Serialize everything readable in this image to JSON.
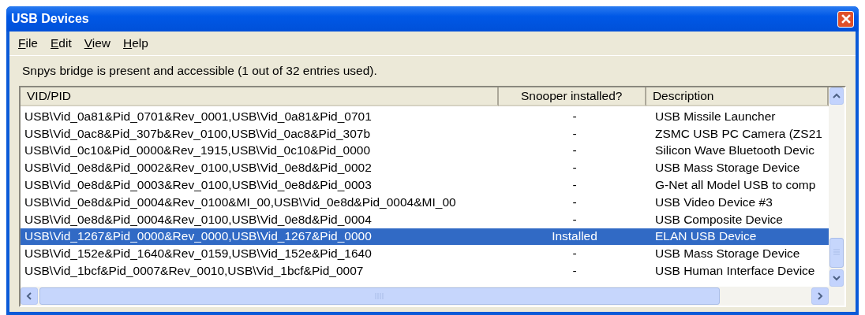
{
  "window": {
    "title": "USB Devices"
  },
  "menu": [
    {
      "label": "File"
    },
    {
      "label": "Edit"
    },
    {
      "label": "View"
    },
    {
      "label": "Help"
    }
  ],
  "status_text": "Snpys bridge is present and accessible (1 out of 32 entries used).",
  "table": {
    "columns": [
      "VID/PID",
      "Snooper installed?",
      "Description"
    ],
    "rows": [
      {
        "vid_pid": "USB\\Vid_0a81&Pid_0701&Rev_0001,USB\\Vid_0a81&Pid_0701",
        "snooper": "-",
        "description": "USB Missile Launcher",
        "selected": false
      },
      {
        "vid_pid": "USB\\Vid_0ac8&Pid_307b&Rev_0100,USB\\Vid_0ac8&Pid_307b",
        "snooper": "-",
        "description": "ZSMC USB PC Camera (ZS21",
        "selected": false
      },
      {
        "vid_pid": "USB\\Vid_0c10&Pid_0000&Rev_1915,USB\\Vid_0c10&Pid_0000",
        "snooper": "-",
        "description": "Silicon Wave Bluetooth Devic",
        "selected": false
      },
      {
        "vid_pid": "USB\\Vid_0e8d&Pid_0002&Rev_0100,USB\\Vid_0e8d&Pid_0002",
        "snooper": "-",
        "description": "USB Mass Storage Device",
        "selected": false
      },
      {
        "vid_pid": "USB\\Vid_0e8d&Pid_0003&Rev_0100,USB\\Vid_0e8d&Pid_0003",
        "snooper": "-",
        "description": "G-Net all Model USB to comp",
        "selected": false
      },
      {
        "vid_pid": "USB\\Vid_0e8d&Pid_0004&Rev_0100&MI_00,USB\\Vid_0e8d&Pid_0004&MI_00",
        "snooper": "-",
        "description": "USB Video Device #3",
        "selected": false
      },
      {
        "vid_pid": "USB\\Vid_0e8d&Pid_0004&Rev_0100,USB\\Vid_0e8d&Pid_0004",
        "snooper": "-",
        "description": "USB Composite Device",
        "selected": false
      },
      {
        "vid_pid": "USB\\Vid_1267&Pid_0000&Rev_0000,USB\\Vid_1267&Pid_0000",
        "snooper": "Installed",
        "description": "ELAN USB Device",
        "selected": true
      },
      {
        "vid_pid": "USB\\Vid_152e&Pid_1640&Rev_0159,USB\\Vid_152e&Pid_1640",
        "snooper": "-",
        "description": "USB Mass Storage Device",
        "selected": false
      },
      {
        "vid_pid": "USB\\Vid_1bcf&Pid_0007&Rev_0010,USB\\Vid_1bcf&Pid_0007",
        "snooper": "-",
        "description": "USB Human Interface Device",
        "selected": false
      }
    ]
  }
}
